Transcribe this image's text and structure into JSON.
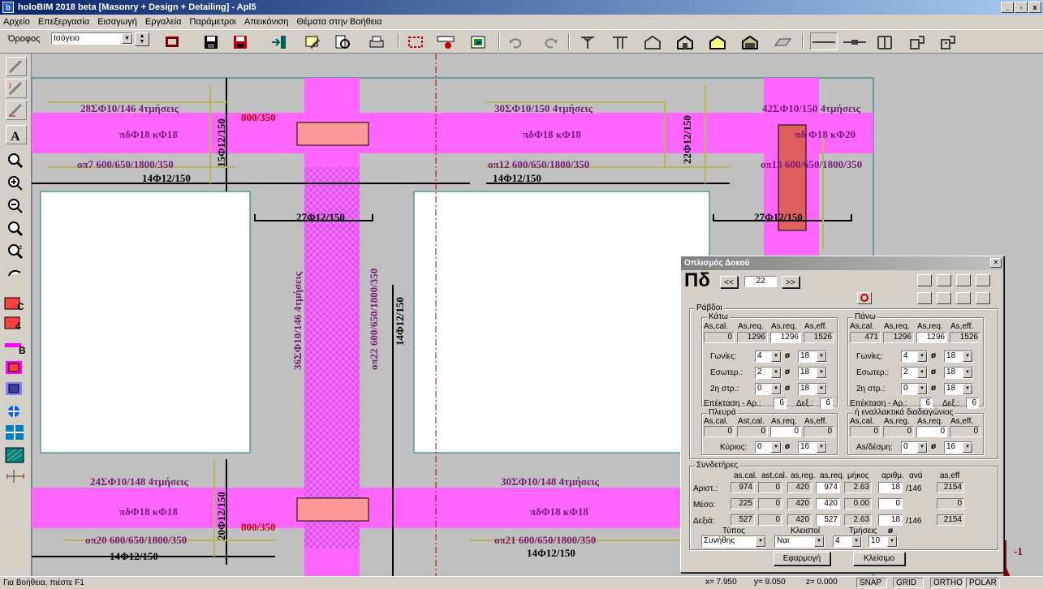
{
  "window": {
    "title": "holoBIM 2018 beta [Masonry + Design + Detailing] - Apl5",
    "app_icon": "b",
    "min": "_",
    "max": "▫",
    "close": "x"
  },
  "menu": [
    "Αρχείο",
    "Επεξεργασία",
    "Εισαγωγή",
    "Εργαλεία",
    "Παράμετροι",
    "Απεικόνιση",
    "Θέματα στην Βοήθεια"
  ],
  "toolbar": {
    "floor_label": "Όροφος",
    "floor_value": "Ισόγειο",
    "icons": [
      "frame-icon",
      "save-icon",
      "save-as-icon",
      "import-icon",
      "tools-icon",
      "preview-icon",
      "print-icon",
      "select-rect-icon",
      "spec-icon",
      "layers-icon",
      "undo-icon",
      "redo-icon",
      "column-single-icon",
      "column-double-icon",
      "house-frame-icon",
      "house-solid-icon",
      "house-yellow-icon",
      "house-green-icon",
      "slab-icon",
      "line-solid-icon",
      "line-dash-icon",
      "wall-frame-icon",
      "room-icon",
      "stair-icon"
    ]
  },
  "left_tools": [
    "edit-icon",
    "edit2-icon",
    "edit3-icon",
    "text-icon",
    "zoom-window-icon",
    "zoom-in-icon",
    "zoom-out-icon",
    "zoom-all-icon",
    "zoom-pm-icon",
    "pan-icon",
    "c-beam-icon",
    "four-icon",
    "b-beam-icon",
    "beam-red-icon",
    "beam-purple-icon",
    "move-icon",
    "grid-icon",
    "hatch-icon",
    "dimension-icon"
  ],
  "drawing": {
    "labels": [
      {
        "t": "28ΣΦ10/146 4τμήσεις",
        "c": "#7a1a7a"
      },
      {
        "t": "30ΣΦ10/150 4τμήσεις",
        "c": "#7a1a7a"
      },
      {
        "t": "42ΣΦ10/150 4τμήσεις",
        "c": "#7a1a7a"
      },
      {
        "t": "πδΦ18 κΦ18",
        "c": "#7a1a7a"
      },
      {
        "t": "πδΦ18 κΦ18",
        "c": "#7a1a7a"
      },
      {
        "t": "πδ Φ18 κΦ20",
        "c": "#7a1a7a"
      },
      {
        "t": "800/350",
        "c": "#d00000"
      },
      {
        "t": "οπ7 600/650/1800/350",
        "c": "#7a1a7a"
      },
      {
        "t": "οπ12 600/650/1800/350",
        "c": "#7a1a7a"
      },
      {
        "t": "οπ13 600/650/1800/350",
        "c": "#7a1a7a"
      },
      {
        "t": "14Φ12/150",
        "c": "#000"
      },
      {
        "t": "14Φ12/150",
        "c": "#000"
      },
      {
        "t": "27Φ12/150",
        "c": "#000"
      },
      {
        "t": "27Φ12/150",
        "c": "#000"
      },
      {
        "t": "24ΣΦ10/148 4τμήσεις",
        "c": "#7a1a7a"
      },
      {
        "t": "30ΣΦ10/148 4τμήσεις",
        "c": "#7a1a7a"
      },
      {
        "t": "πδΦ18 κΦ18",
        "c": "#7a1a7a"
      },
      {
        "t": "πδΦ18 κΦ18",
        "c": "#7a1a7a"
      },
      {
        "t": "800/350",
        "c": "#d00000"
      },
      {
        "t": "οπ20 600/650/1800/350",
        "c": "#7a1a7a"
      },
      {
        "t": "οπ21 600/650/1800/350",
        "c": "#7a1a7a"
      },
      {
        "t": "14Φ12/150",
        "c": "#000"
      },
      {
        "t": "14Φ12/150",
        "c": "#000"
      },
      {
        "t": "36ΣΦ10/146 4τμήσεις",
        "c": "#7a1a7a"
      },
      {
        "t": "οπ22 600/650/1800/350",
        "c": "#7a1a7a"
      },
      {
        "t": "14Φ12/150",
        "c": "#000"
      },
      {
        "t": "15Φ12/150",
        "c": "#000"
      },
      {
        "t": "22Φ12/150",
        "c": "#000"
      },
      {
        "t": "20Φ12/150",
        "c": "#000"
      },
      {
        "t": "-1",
        "c": "#8b0000"
      }
    ]
  },
  "dialog": {
    "title": "Οπλισμός Δοκού",
    "beam_name": "Πδ",
    "prev": "<<",
    "next": ">>",
    "beam_no": "22",
    "bars_group": "Ράβδοι",
    "bottom_group": "Κάτω",
    "top_group": "Πάνω",
    "col_headers": [
      "As,cal.",
      "As,req.",
      "As,req.",
      "As,eff."
    ],
    "bottom_values": [
      "0",
      "1296",
      "1296",
      "1526"
    ],
    "top_values": [
      "471",
      "1296",
      "1296",
      "1526"
    ],
    "rows": [
      "Γωνίες:",
      "Εσωτερ.:",
      "2η στρ.:"
    ],
    "phi": "ø",
    "bottom_counts": [
      "4",
      "2",
      "0"
    ],
    "bottom_dias": [
      "18",
      "18",
      "18"
    ],
    "top_counts": [
      "4",
      "2",
      "0"
    ],
    "top_dias": [
      "18",
      "18",
      "18"
    ],
    "extension_label": "Επέκταση - Αρ.:",
    "right_label": "Δεξ.:",
    "bottom_ext": [
      "6",
      "6"
    ],
    "top_ext": [
      "6",
      "6"
    ],
    "side_group": "Πλευρά",
    "side_headers": [
      "As,cal.",
      "Ast,cal.",
      "As,req.",
      "As,eff."
    ],
    "side_values": [
      "0",
      "0",
      "0",
      "0"
    ],
    "main_label": "Κύριος:",
    "side_count": "0",
    "side_dia": "16",
    "diag_group": "ή εναλλακτικά διαδιαγώνιος",
    "diag_headers": [
      "As,cal.",
      "As,reg.",
      "As,req.",
      "As,eff."
    ],
    "diag_values": [
      "0",
      "0",
      "0",
      "0"
    ],
    "diag_label": "As/δέσμη:",
    "diag_count": "0",
    "diag_dia": "16",
    "stirrups_group": "Συνδετήρες",
    "stirrup_headers": [
      "as,cal.",
      "ast,cal.",
      "as,reg.",
      "as,req.",
      "μήκος",
      "αριθμ.",
      "ανά",
      "as,eff"
    ],
    "stirrup_rows": [
      {
        "label": "Αριστ.:",
        "v": [
          "974",
          "0",
          "420",
          "974",
          "2.63",
          "18",
          "/146",
          "2154"
        ]
      },
      {
        "label": "Μέσο:",
        "v": [
          "225",
          "0",
          "420",
          "420",
          "0.00",
          "0",
          "",
          "0"
        ]
      },
      {
        "label": "Δεξιά:",
        "v": [
          "527",
          "0",
          "420",
          "527",
          "2.63",
          "18",
          "/146",
          "2154"
        ]
      }
    ],
    "type_label": "Τύπος",
    "closed_label": "Κλειστοί",
    "cuts_label": "Τμήσεις",
    "type_value": "Συνήθης",
    "closed_value": "Ναι",
    "cuts_value": "4",
    "dia_value": "10",
    "apply": "Εφαρμογή",
    "close": "Κλείσιμο"
  },
  "status": {
    "help": "Για Βοήθεια, πιέστε F1",
    "x": "x= 7.950",
    "y": "y= 9.050",
    "z": "z= 0.000",
    "snap": "SNAP",
    "grid": "GRID",
    "ortho": "ORTHO",
    "polar": "POLAR"
  },
  "colors": {
    "magenta": "#ff66ff",
    "teal": "#008080",
    "olive": "#b8b45a",
    "label": "#7a1a7a",
    "red": "#d00000"
  }
}
